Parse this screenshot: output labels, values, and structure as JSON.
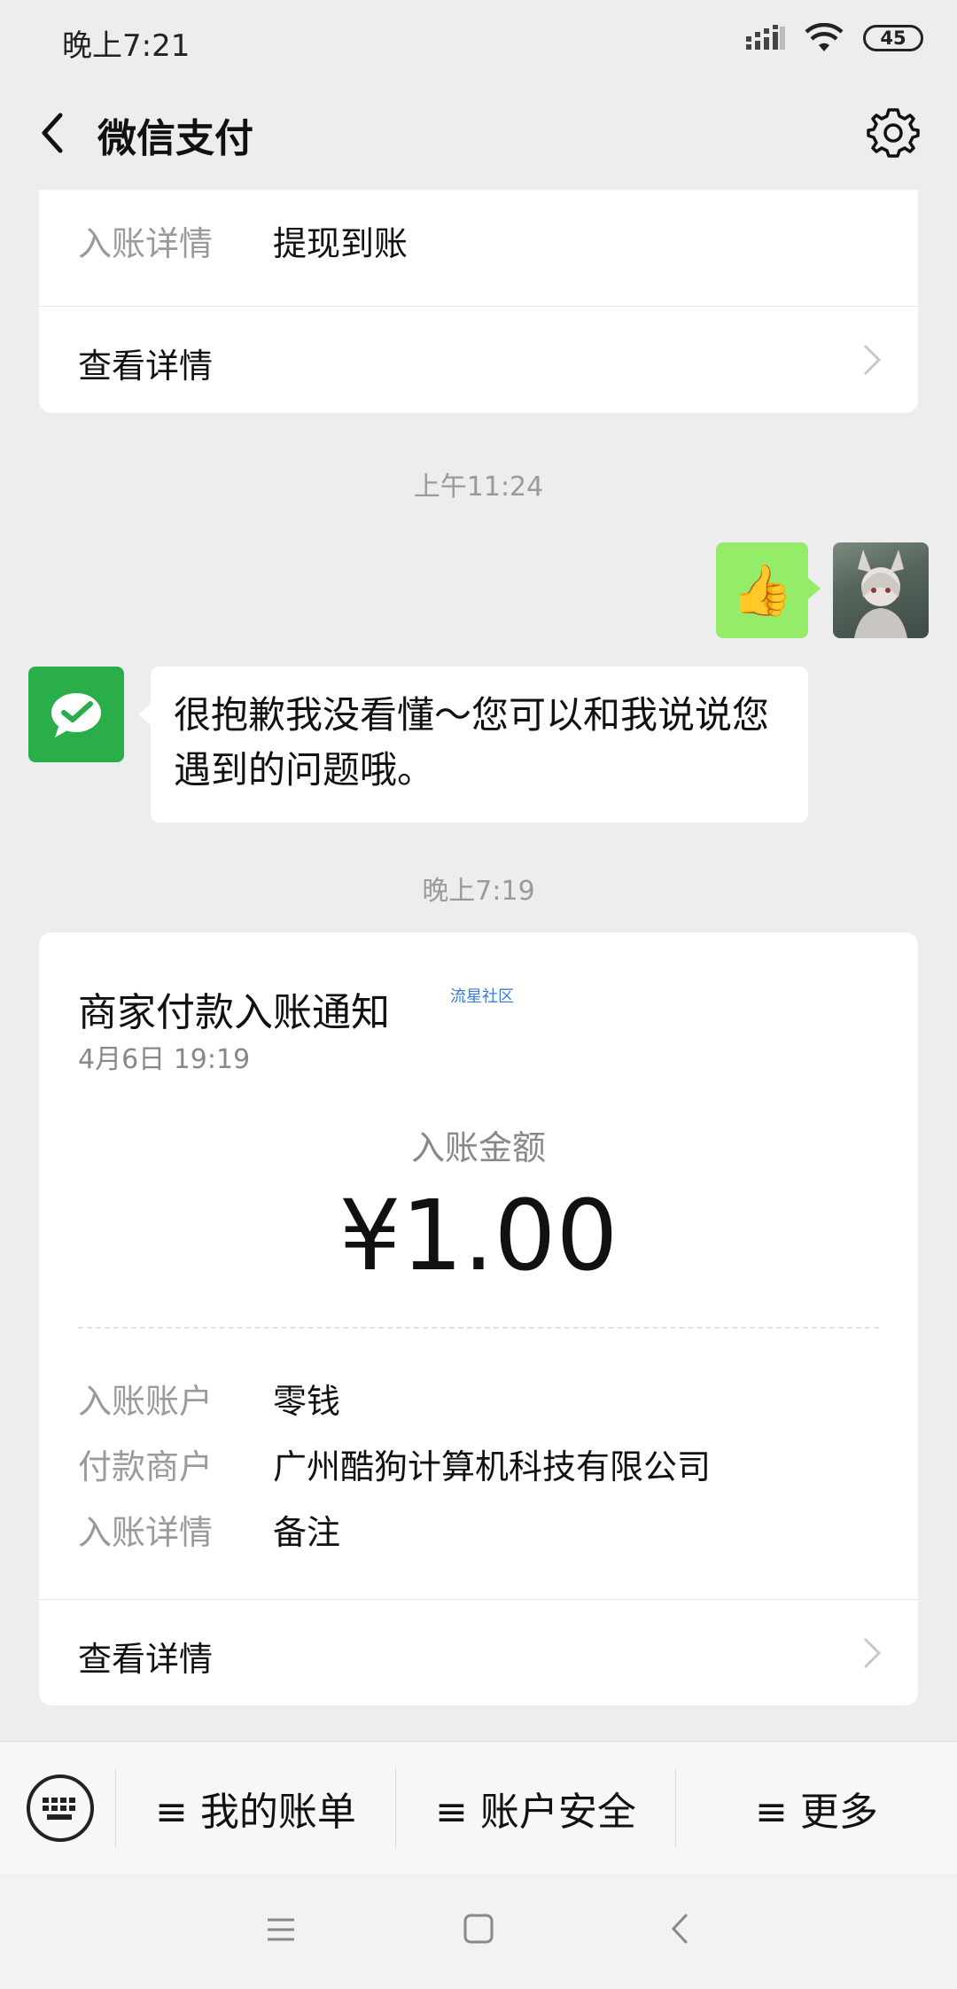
{
  "status_bar": {
    "time": "晚上7:21",
    "battery": "45"
  },
  "nav": {
    "title": "微信支付"
  },
  "card1": {
    "label": "入账详情",
    "value": "提现到账",
    "detail_link": "查看详情"
  },
  "chat": {
    "timestamp1": "上午11:24",
    "sent_emoji": "👍",
    "reply_text": "很抱歉我没看懂～您可以和我说说您遇到的问题哦。",
    "timestamp2": "晚上7:19"
  },
  "card2": {
    "title": "商家付款入账通知",
    "watermark": "流星社区",
    "date": "4月6日  19:19",
    "amount_label": "入账金额",
    "amount": "¥1.00",
    "rows": [
      {
        "label": "入账账户",
        "value": "零钱"
      },
      {
        "label": "付款商户",
        "value": "广州酷狗计算机科技有限公司"
      },
      {
        "label": "入账详情",
        "value": "备注"
      }
    ],
    "detail_link": "查看详情"
  },
  "menu": {
    "items": [
      {
        "label": "≡ 我的账单"
      },
      {
        "label": "≡ 账户安全"
      },
      {
        "label": "≡ 更多"
      }
    ]
  },
  "colors": {
    "accent_green": "#2aae4a",
    "bubble_green": "#95ec69",
    "background": "#ededed"
  }
}
